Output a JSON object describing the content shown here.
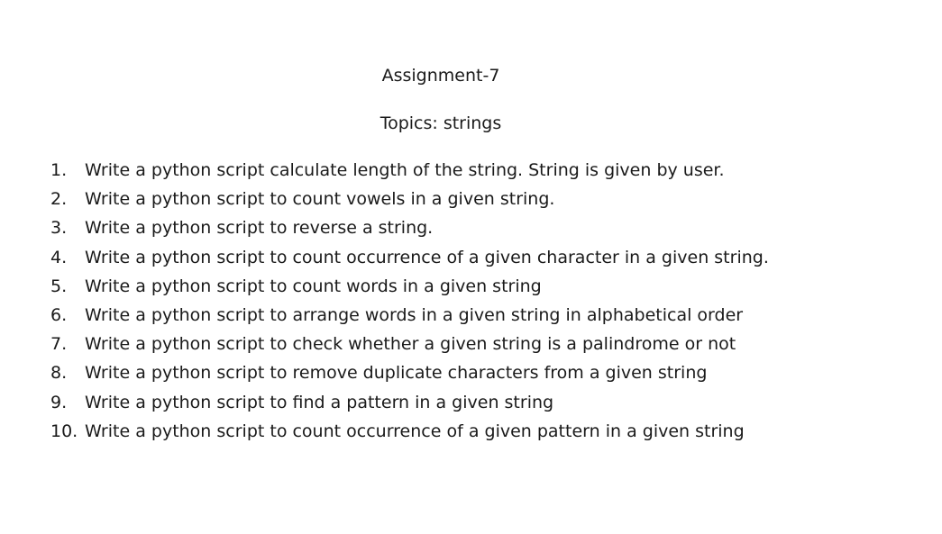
{
  "document": {
    "title": "Assignment-7",
    "subtitle": "Topics: strings",
    "items": [
      {
        "num": "1.",
        "text": "Write a python script calculate length of the string. String is given by user."
      },
      {
        "num": "2.",
        "text": "Write a python script to count vowels in a given string."
      },
      {
        "num": "3.",
        "text": "Write a python script to reverse a string."
      },
      {
        "num": "4.",
        "text": "Write a python script to count occurrence of a given character in a given string."
      },
      {
        "num": "5.",
        "text": "Write a python script to count words in a given string"
      },
      {
        "num": "6.",
        "text": "Write a python script to arrange words in a given string in alphabetical order"
      },
      {
        "num": "7.",
        "text": "Write a python script to check whether a given string is a palindrome or not"
      },
      {
        "num": "8.",
        "text": "Write a python script to remove duplicate characters from a given string"
      },
      {
        "num": "9.",
        "text": "Write a python script to find a pattern in a given string"
      },
      {
        "num": "10.",
        "text": "Write a python script to count occurrence of a given pattern in a given string"
      }
    ]
  }
}
